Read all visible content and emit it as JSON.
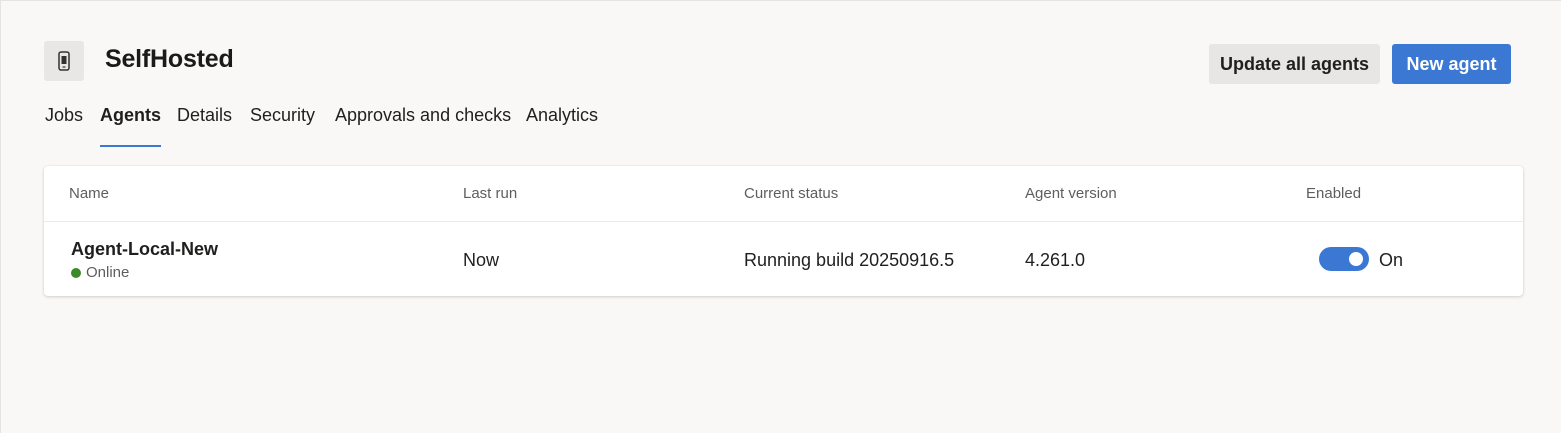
{
  "header": {
    "title": "SelfHosted",
    "icon": "phone-device-icon",
    "buttons": {
      "update_all": "Update all agents",
      "new_agent": "New agent"
    }
  },
  "tabs": [
    {
      "label": "Jobs",
      "active": false
    },
    {
      "label": "Agents",
      "active": true
    },
    {
      "label": "Details",
      "active": false
    },
    {
      "label": "Security",
      "active": false
    },
    {
      "label": "Approvals and checks",
      "active": false
    },
    {
      "label": "Analytics",
      "active": false
    }
  ],
  "table": {
    "columns": [
      "Name",
      "Last run",
      "Current status",
      "Agent version",
      "Enabled"
    ],
    "rows": [
      {
        "name": "Agent-Local-New",
        "status": "Online",
        "last_run": "Now",
        "current_status": "Running build 20250916.5",
        "agent_version": "4.261.0",
        "enabled_label": "On",
        "enabled": true
      }
    ]
  },
  "colors": {
    "accent": "#3b78d4",
    "online": "#3d8a2a",
    "background": "#faf7f7"
  }
}
